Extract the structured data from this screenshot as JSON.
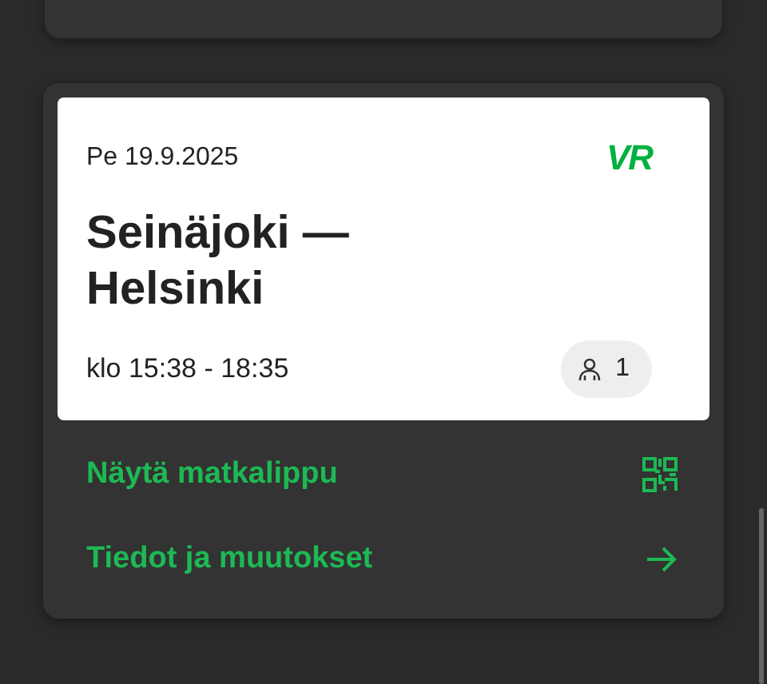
{
  "ticket": {
    "date": "Pe 19.9.2025",
    "logo": "VR",
    "route": "Seinäjoki —\nHelsinki",
    "time": "klo 15:38 - 18:35",
    "passengers": "1"
  },
  "actions": [
    {
      "label": "Näytä matkalippu",
      "kind": "qr"
    },
    {
      "label": "Tiedot ja muutokset",
      "kind": "arrow"
    }
  ]
}
